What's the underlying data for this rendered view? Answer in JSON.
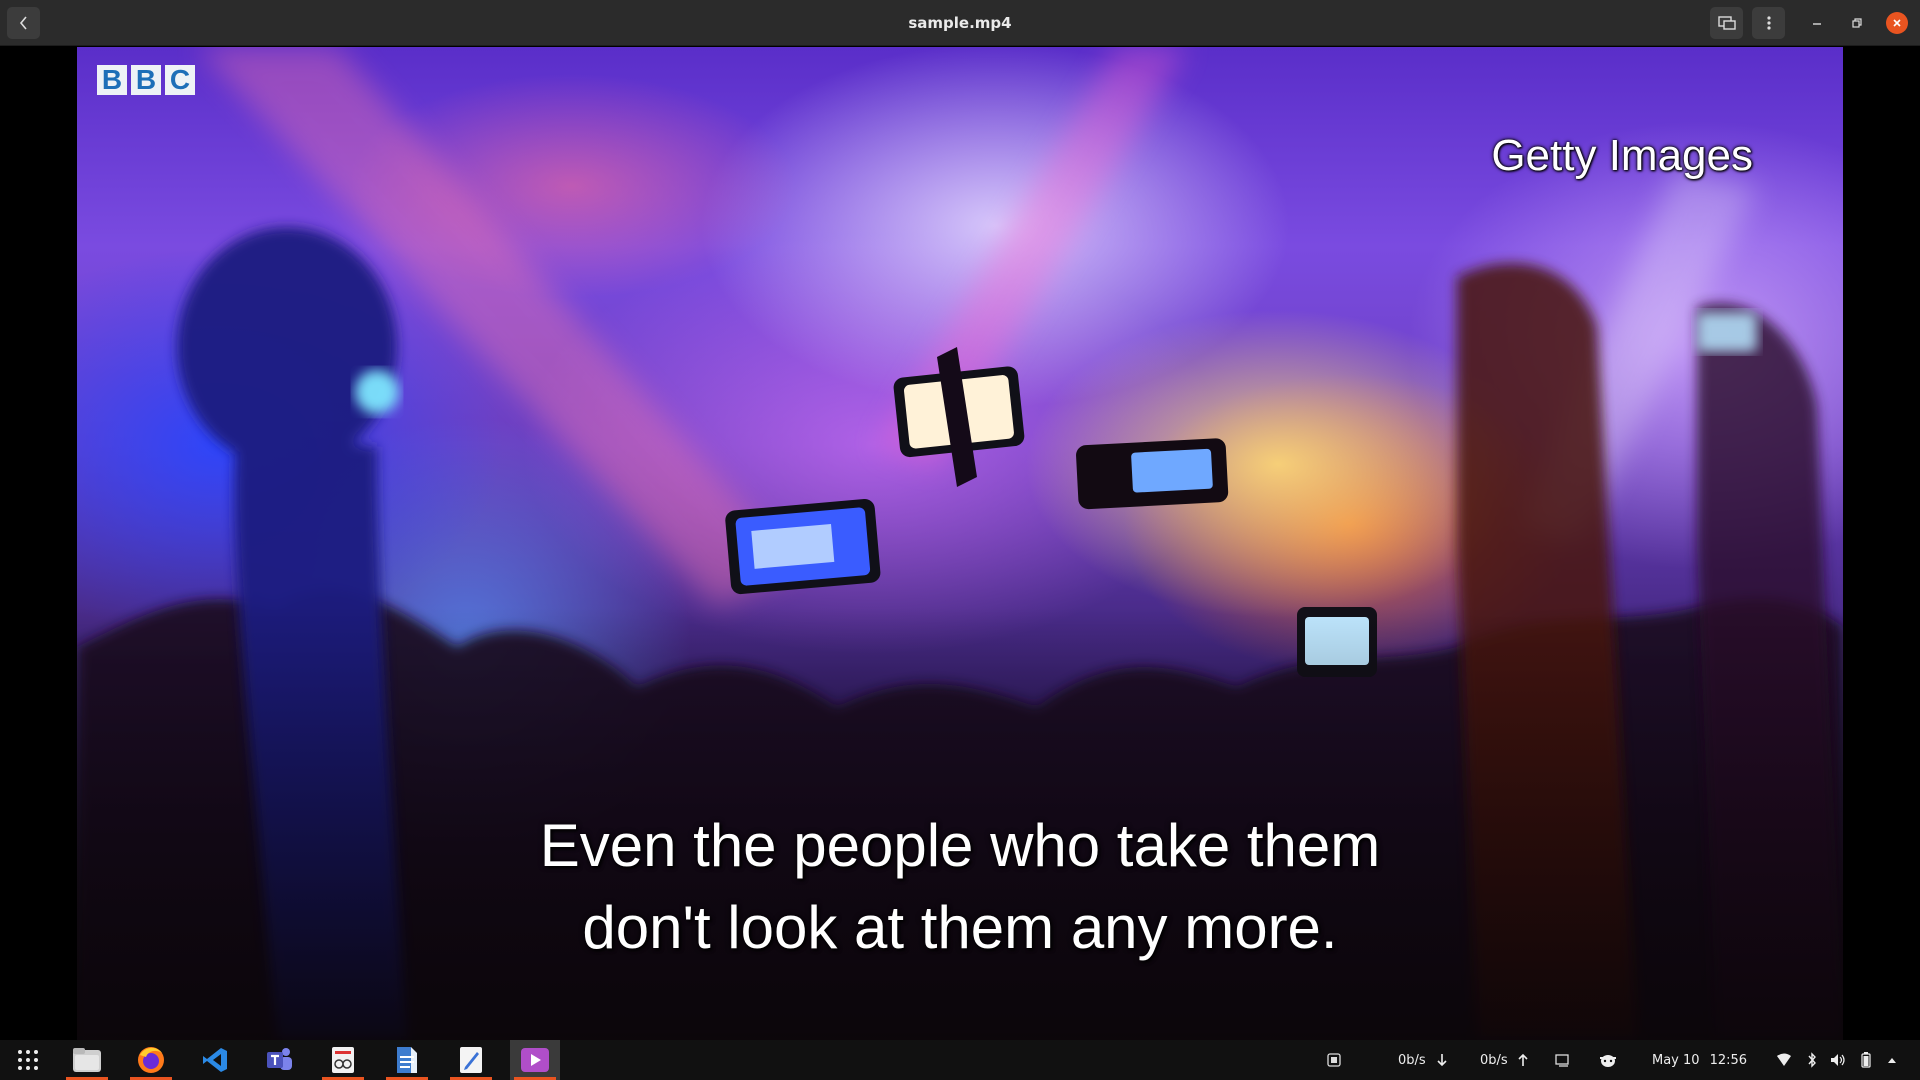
{
  "window": {
    "title": "sample.mp4"
  },
  "video": {
    "logo_letters": [
      "B",
      "B",
      "C"
    ],
    "watermark": "Getty Images",
    "subtitle_lines": [
      "Even the people who take them",
      "don't look at them any more."
    ]
  },
  "taskbar": {
    "apps": [
      {
        "name": "app-grid",
        "running": false
      },
      {
        "name": "files",
        "running": true
      },
      {
        "name": "firefox",
        "running": true
      },
      {
        "name": "vscode",
        "running": false
      },
      {
        "name": "teams",
        "running": false
      },
      {
        "name": "document-viewer",
        "running": true
      },
      {
        "name": "writer",
        "running": true
      },
      {
        "name": "text-editor",
        "running": true
      },
      {
        "name": "video-player",
        "running": true,
        "active": true
      }
    ],
    "net_down": "0b/s",
    "net_up": "0b/s",
    "date": "May 10",
    "time": "12:56"
  },
  "colors": {
    "accent": "#e95420",
    "titlebar": "#2b2b2b",
    "taskbar": "#111111"
  }
}
